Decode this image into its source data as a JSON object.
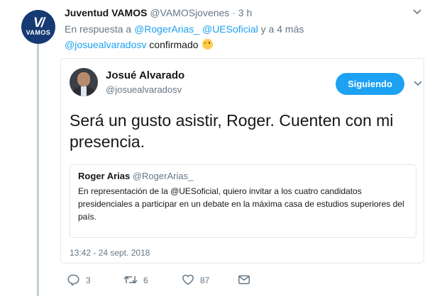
{
  "tweet": {
    "author_name": "Juventud VAMOS",
    "author_handle": "@VAMOSjovenes",
    "separator": " · ",
    "time_ago": "3 h",
    "avatar_mark": "V/",
    "avatar_brand": "VAMOS",
    "reply_prefix": "En respuesta a ",
    "reply_mention_1": "@RogerArias_",
    "reply_mention_2": "@UESoficial",
    "reply_suffix": " y a 4 más",
    "text_mention": "@josuealvaradosv",
    "text_body": " confirmado",
    "emoji": "winking-face"
  },
  "quoted": {
    "author_name": "Josué Alvarado",
    "author_handle": "@josuealvaradosv",
    "follow_label": "Siguiendo",
    "text": "Será un gusto asistir, Roger. Cuenten con mi presencia.",
    "timestamp": "13:42 - 24 sept. 2018",
    "inner": {
      "author_name": "Roger Arias",
      "author_handle": "@RogerArias_",
      "text": "En representación de la @UESoficial, quiero invitar a los cuatro candidatos presidenciales a participar en un debate en la máxima casa de estudios superiores del país."
    }
  },
  "actions": {
    "replies": "3",
    "retweets": "6",
    "likes": "87"
  },
  "colors": {
    "accent": "#1da1f2",
    "muted": "#657786",
    "border": "#e1e8ed"
  }
}
